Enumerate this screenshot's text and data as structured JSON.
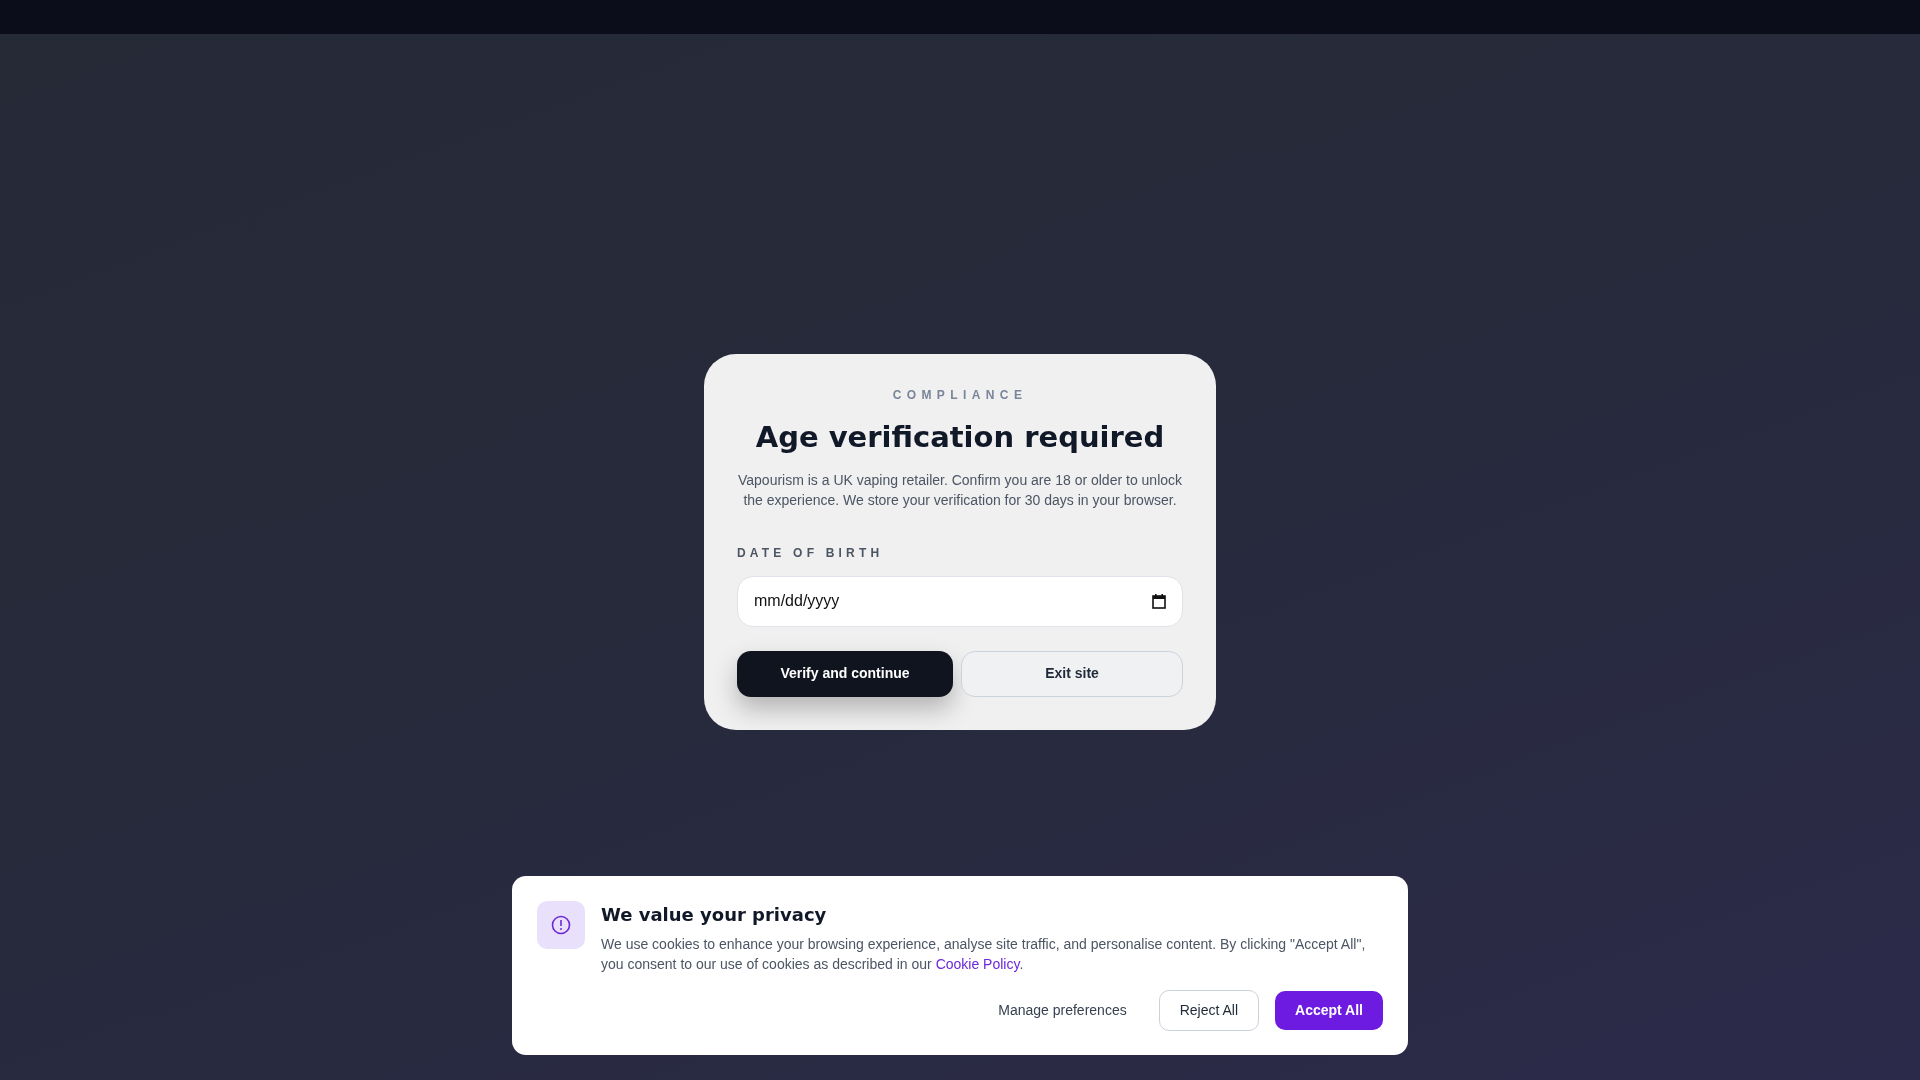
{
  "age_gate": {
    "eyebrow": "COMPLIANCE",
    "title": "Age verification required",
    "description": "Vapourism is a UK vaping retailer. Confirm you are 18 or older to unlock the experience. We store your verification for 30 days in your browser.",
    "field_label": "DATE OF BIRTH",
    "date_field": {
      "placeholder": "mm/dd/yyyy"
    },
    "buttons": [
      {
        "label": "Verify and continue",
        "kind": "primary"
      },
      {
        "label": "Exit site",
        "kind": "outline"
      }
    ]
  },
  "cookie_banner": {
    "title": "We value your privacy",
    "text_before": "We use cookies to enhance your browsing experience, analyse site traffic, and personalise content. By clicking \"Accept All\", you consent to our use of cookies as described in our ",
    "link": "Cookie Policy",
    "text_after": ".",
    "buttons": [
      {
        "label": "Manage preferences",
        "kind": "text"
      },
      {
        "label": "Reject All",
        "kind": "outline"
      },
      {
        "label": "Accept All",
        "kind": "primary"
      }
    ]
  }
}
